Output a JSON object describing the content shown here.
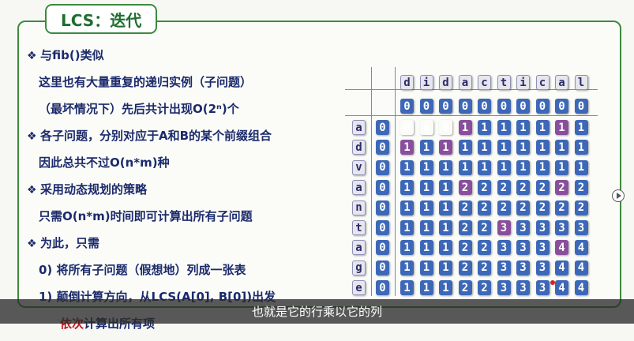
{
  "title": "LCS：迭代",
  "bullets": [
    {
      "text": "与fib()类似",
      "lines": [
        "这里也有大量重复的递归实例（子问题）",
        "（最坏情况下）先后共计出现O(2ⁿ)个"
      ]
    },
    {
      "text": "各子问题，分别对应于A和B的某个前缀组合",
      "lines": [
        "因此总共不过O(n*m)种"
      ]
    },
    {
      "text": "采用动态规划的策略",
      "lines": [
        "只需O(n*m)时间即可计算出所有子问题"
      ]
    },
    {
      "text": "为此，只需",
      "lines": [
        "0) 将所有子问题（假想地）列成一张表",
        "1) 颠倒计算方向，从LCS(A[0], B[0])出发"
      ]
    }
  ],
  "highlight_line": {
    "red": "依次",
    "rest": "计算出所有项"
  },
  "table": {
    "top_letters": [
      "d",
      "i",
      "d",
      "a",
      "c",
      "t",
      "i",
      "c",
      "a",
      "l"
    ],
    "side_letters": [
      "a",
      "d",
      "v",
      "a",
      "n",
      "t",
      "a",
      "g",
      "e"
    ],
    "zero_row": [
      0,
      0,
      0,
      0,
      0,
      0,
      0,
      0,
      0,
      0
    ],
    "rows": [
      [
        0,
        0,
        0,
        1,
        1,
        1,
        1,
        1,
        1,
        1
      ],
      [
        1,
        1,
        1,
        1,
        1,
        1,
        1,
        1,
        1,
        1
      ],
      [
        1,
        1,
        1,
        1,
        1,
        1,
        1,
        1,
        1,
        1
      ],
      [
        1,
        1,
        1,
        2,
        2,
        2,
        2,
        2,
        2,
        2
      ],
      [
        1,
        1,
        1,
        2,
        2,
        2,
        2,
        2,
        2,
        2
      ],
      [
        1,
        1,
        1,
        2,
        2,
        3,
        3,
        3,
        3,
        3
      ],
      [
        1,
        1,
        1,
        2,
        2,
        3,
        3,
        3,
        4,
        4
      ],
      [
        1,
        1,
        1,
        2,
        2,
        3,
        3,
        3,
        4,
        4
      ],
      [
        1,
        1,
        1,
        2,
        2,
        3,
        3,
        3,
        4,
        4
      ]
    ],
    "matches": [
      [
        0,
        3
      ],
      [
        0,
        8
      ],
      [
        1,
        0
      ],
      [
        1,
        2
      ],
      [
        3,
        3
      ],
      [
        3,
        8
      ],
      [
        5,
        5
      ],
      [
        6,
        8
      ]
    ]
  },
  "subtitle": "也就是它的行乘以它的列"
}
